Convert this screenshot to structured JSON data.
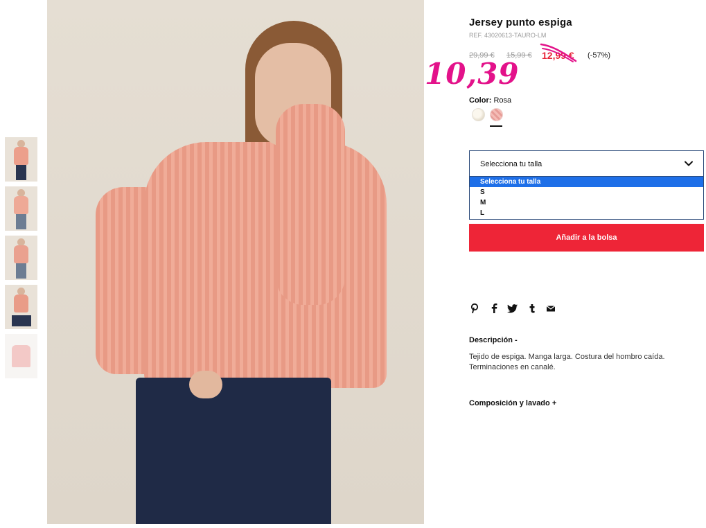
{
  "product": {
    "title": "Jersey punto espiga",
    "ref": "REF. 43020613-TAURO-LM",
    "price_original": "29,99 €",
    "price_previous": "15,99 €",
    "price_current": "12,99 €",
    "discount": "(-57%)",
    "handwritten_price": "10,39"
  },
  "color": {
    "label": "Color:",
    "value": "Rosa",
    "swatches": [
      "cream",
      "rosa"
    ]
  },
  "size_select": {
    "label": "Selecciona tu talla",
    "options": [
      "Selecciona tu talla",
      "S",
      "M",
      "L"
    ]
  },
  "add_button": "Añadir a la bolsa",
  "share_icons": [
    "pinterest-icon",
    "facebook-icon",
    "twitter-icon",
    "tumblr-icon",
    "email-icon"
  ],
  "description": {
    "heading": "Descripción",
    "toggle": "-",
    "text": "Tejido de espiga. Manga larga. Costura del hombro caída. Terminaciones en canalé."
  },
  "composition": {
    "heading": "Composición y lavado",
    "toggle": "+"
  },
  "colors": {
    "sale_red": "#ee2537",
    "select_border": "#2b4a7a",
    "option_highlight": "#1e6fe8",
    "handwritten_pink": "#e3128a"
  }
}
